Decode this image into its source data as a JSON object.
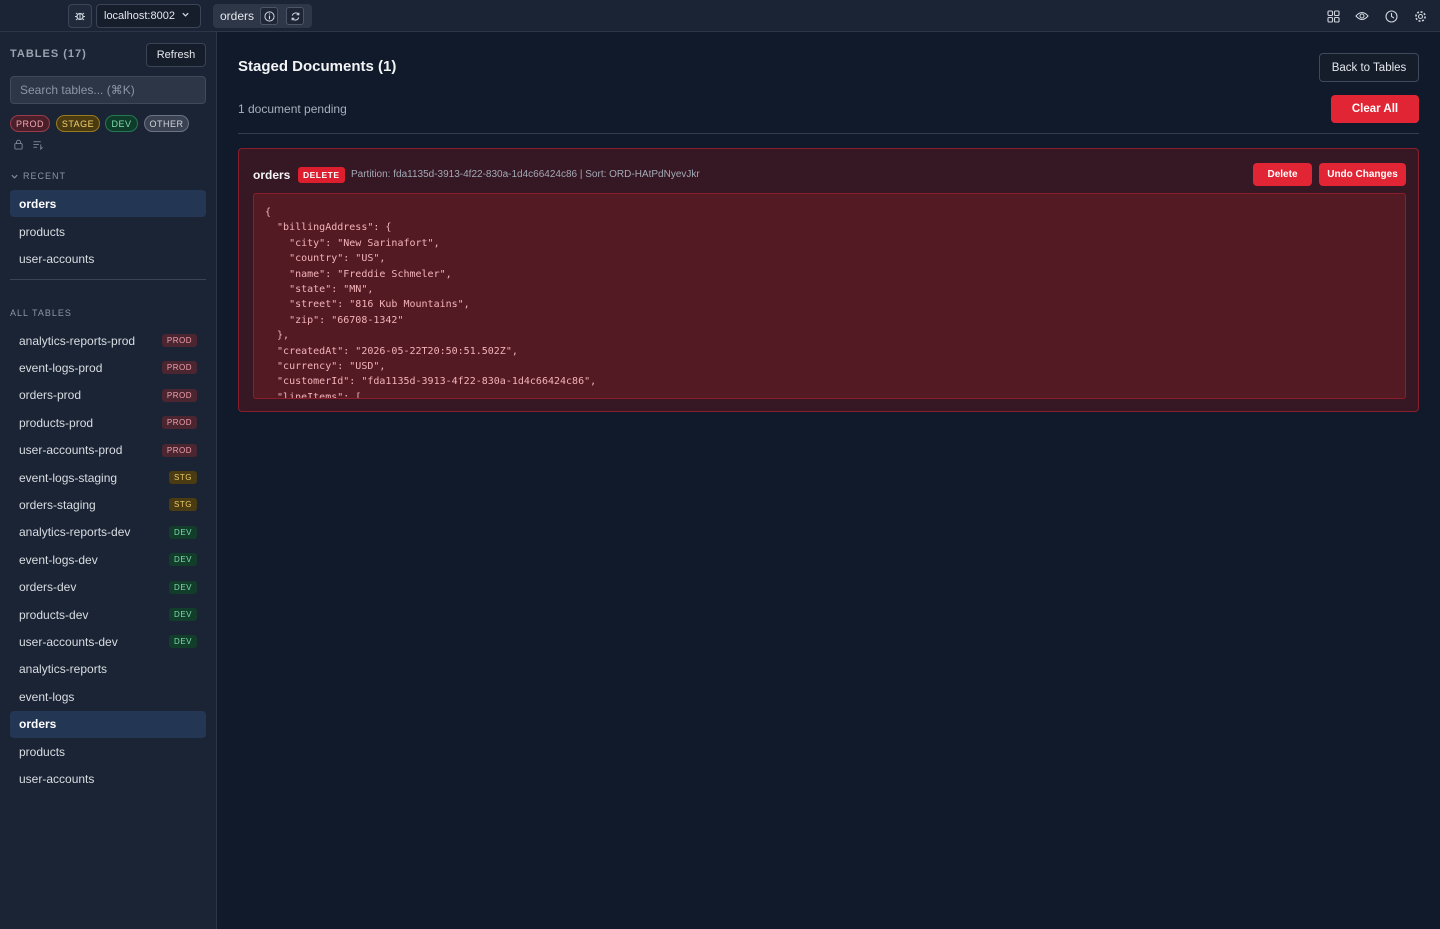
{
  "topbar": {
    "host": "localhost:8002",
    "tab": "orders",
    "icons": [
      "bug-icon",
      "chevron-down-icon",
      "info-icon",
      "refresh-icon",
      "grid-icon",
      "eye-icon",
      "clock-icon",
      "gear-icon"
    ]
  },
  "sidebar": {
    "title": "TABLES (17)",
    "refresh_label": "Refresh",
    "search_placeholder": "Search tables... (⌘K)",
    "filters": [
      "PROD",
      "STAGE",
      "DEV",
      "OTHER"
    ],
    "recent_label": "RECENT",
    "recent": [
      {
        "label": "orders",
        "active": true
      },
      {
        "label": "products",
        "active": false
      },
      {
        "label": "user-accounts",
        "active": false
      }
    ],
    "all_label": "ALL TABLES",
    "tables": [
      {
        "label": "analytics-reports-prod",
        "tag": "PROD",
        "tag_class": "prod"
      },
      {
        "label": "event-logs-prod",
        "tag": "PROD",
        "tag_class": "prod"
      },
      {
        "label": "orders-prod",
        "tag": "PROD",
        "tag_class": "prod"
      },
      {
        "label": "products-prod",
        "tag": "PROD",
        "tag_class": "prod"
      },
      {
        "label": "user-accounts-prod",
        "tag": "PROD",
        "tag_class": "prod"
      },
      {
        "label": "event-logs-staging",
        "tag": "STG",
        "tag_class": "stg"
      },
      {
        "label": "orders-staging",
        "tag": "STG",
        "tag_class": "stg"
      },
      {
        "label": "analytics-reports-dev",
        "tag": "DEV",
        "tag_class": "dev"
      },
      {
        "label": "event-logs-dev",
        "tag": "DEV",
        "tag_class": "dev"
      },
      {
        "label": "orders-dev",
        "tag": "DEV",
        "tag_class": "dev"
      },
      {
        "label": "products-dev",
        "tag": "DEV",
        "tag_class": "dev"
      },
      {
        "label": "user-accounts-dev",
        "tag": "DEV",
        "tag_class": "dev"
      },
      {
        "label": "analytics-reports",
        "tag": "",
        "tag_class": ""
      },
      {
        "label": "event-logs",
        "tag": "",
        "tag_class": ""
      },
      {
        "label": "orders",
        "tag": "",
        "tag_class": "",
        "active": true
      },
      {
        "label": "products",
        "tag": "",
        "tag_class": ""
      },
      {
        "label": "user-accounts",
        "tag": "",
        "tag_class": ""
      }
    ]
  },
  "main": {
    "title": "Staged Documents (1)",
    "back_label": "Back to Tables",
    "pending": "1 document pending",
    "clear_label": "Clear All",
    "card": {
      "table": "orders",
      "badge": "DELETE",
      "meta": "Partition: fda1135d-3913-4f22-830a-1d4c66424c86 | Sort: ORD-HAtPdNyevJkr",
      "delete_label": "Delete",
      "undo_label": "Undo Changes",
      "code": "{\n  \"billingAddress\": {\n    \"city\": \"New Sarinafort\",\n    \"country\": \"US\",\n    \"name\": \"Freddie Schmeler\",\n    \"state\": \"MN\",\n    \"street\": \"816 Kub Mountains\",\n    \"zip\": \"66708-1342\"\n  },\n  \"createdAt\": \"2026-05-22T20:50:51.502Z\",\n  \"currency\": \"USD\",\n  \"customerId\": \"fda1135d-3913-4f22-830a-1d4c66424c86\",\n  \"lineItems\": ["
    }
  },
  "colors": {
    "accent_red": "#e22535",
    "active_item": "#233654",
    "background": "#101828"
  }
}
